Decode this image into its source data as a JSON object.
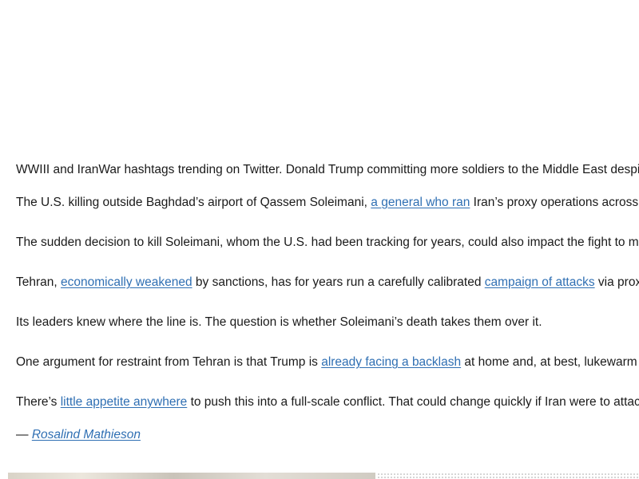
{
  "article": {
    "p0": {
      "text": "WWIII and IranWar hashtags trending on Twitter. Donald Trump committing more soldiers to the Middle East despi"
    },
    "p1": {
      "before": "The U.S. killing outside Baghdad’s airport of Qassem Soleimani, ",
      "link": "a general who ran",
      "after": " Iran’s proxy operations across"
    },
    "p2": {
      "text": "The sudden decision to kill Soleimani, whom the U.S. had been tracking for years, could also impact the fight to m"
    },
    "p3": {
      "before": "Tehran, ",
      "link1": "economically weakened",
      "middle": " by sanctions, has for years run a carefully calibrated ",
      "link2": "campaign of attacks",
      "after": " via prox"
    },
    "p4": {
      "text": "Its leaders knew where the line is. The question is whether Soleimani’s death takes them over it."
    },
    "p5": {
      "before": "One argument for restraint from Tehran is that Trump is ",
      "link": "already facing a backlash",
      "after": " at home and, at best, lukewarm s"
    },
    "p6": {
      "before": "There’s ",
      "link": "little appetite anywhere",
      "after": " to push this into a full-scale conflict. That could change quickly if Iran were to attack"
    },
    "byline": {
      "dash": "— ",
      "author": "Rosalind Mathieson"
    }
  },
  "colors": {
    "link": "#2f6fb3",
    "text": "#1a1a1a",
    "background": "#ffffff"
  }
}
